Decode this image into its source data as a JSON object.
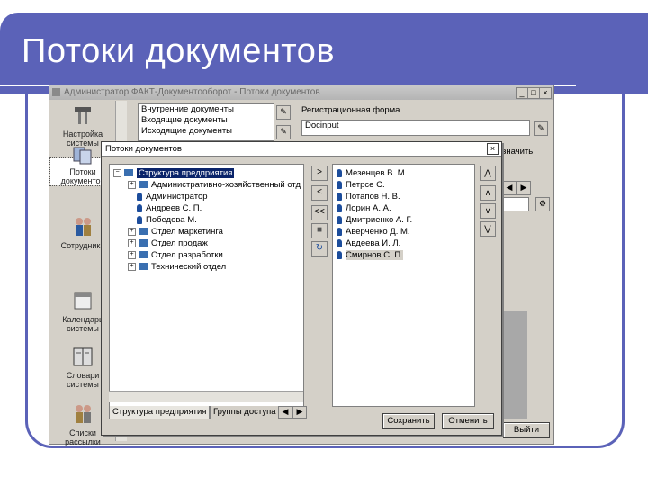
{
  "slide": {
    "title": "Потоки документов"
  },
  "window": {
    "title": "Администратор ФАКТ-Документооборот - Потоки документов",
    "min_label": "_",
    "max_label": "□",
    "close_label": "×"
  },
  "sidebar": {
    "items": [
      {
        "label": "Настройка системы",
        "icon": "tools-icon"
      },
      {
        "label": "Потоки документов",
        "icon": "documents-icon"
      },
      {
        "label": "Сотрудники",
        "icon": "users-icon"
      },
      {
        "label": "Календарь системы",
        "icon": "calendar-icon"
      },
      {
        "label": "Словари системы",
        "icon": "book-icon"
      },
      {
        "label": "Списки рассылки",
        "icon": "mailing-icon"
      }
    ]
  },
  "background": {
    "doc_types": [
      "Внутренние документы",
      "Входящие документы",
      "Исходящие документы"
    ],
    "form_label": "Регистрационная форма",
    "form_value": "Docinput",
    "right_label": "значить",
    "exit_button": "Выйти"
  },
  "dialog": {
    "title": "Потоки документов",
    "close_label": "×",
    "tree": [
      {
        "label": "Структура предприятия",
        "level": 0,
        "kind": "root",
        "selected": true
      },
      {
        "label": "Административно-хозяйственный отд",
        "level": 1,
        "kind": "group"
      },
      {
        "label": "Администратор",
        "level": 1,
        "kind": "person"
      },
      {
        "label": "Андреев С. П.",
        "level": 1,
        "kind": "person"
      },
      {
        "label": "Победова М.",
        "level": 1,
        "kind": "person"
      },
      {
        "label": "Отдел маркетинга",
        "level": 1,
        "kind": "group"
      },
      {
        "label": "Отдел продаж",
        "level": 1,
        "kind": "group"
      },
      {
        "label": "Отдел разработки",
        "level": 1,
        "kind": "group"
      },
      {
        "label": "Технический отдел",
        "level": 1,
        "kind": "group"
      }
    ],
    "move_buttons": [
      ">",
      "<",
      "<<",
      "■",
      "↻"
    ],
    "selected_list": [
      {
        "label": "Мезенцев В. М",
        "selected": false
      },
      {
        "label": "Петрсе С.",
        "selected": false
      },
      {
        "label": "Потапов Н. В.",
        "selected": false
      },
      {
        "label": "Лорин А. А.",
        "selected": false
      },
      {
        "label": "Дмитриенко А. Г.",
        "selected": false
      },
      {
        "label": "Аверченко Д. М.",
        "selected": false
      },
      {
        "label": "Авдеева И. Л.",
        "selected": false
      },
      {
        "label": "Смирнов С. П.",
        "selected": true
      }
    ],
    "order_buttons": [
      "⋀",
      "∧",
      "∨",
      "⋁"
    ],
    "tabs": [
      "Структура предприятия",
      "Группы доступа"
    ],
    "tab_nav": [
      "◀",
      "▶"
    ],
    "save_button": "Сохранить",
    "cancel_button": "Отменить"
  }
}
